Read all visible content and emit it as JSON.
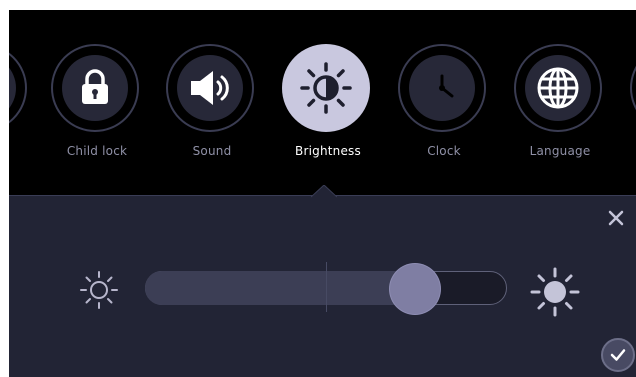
{
  "menu": {
    "items": [
      {
        "label": "",
        "icon": "partial-icon"
      },
      {
        "label": "Child lock",
        "icon": "padlock-icon"
      },
      {
        "label": "Sound",
        "icon": "speaker-icon"
      },
      {
        "label": "Brightness",
        "icon": "brightness-icon",
        "active": true
      },
      {
        "label": "Clock",
        "icon": "clock-icon"
      },
      {
        "label": "Language",
        "icon": "globe-icon"
      },
      {
        "label": "",
        "icon": "partial-icon"
      }
    ]
  },
  "brightness": {
    "level": 0.77
  },
  "colors": {
    "background": "#000000",
    "panel": "#222435",
    "active_circle": "#c9c8df",
    "thumb": "#7f7ea3",
    "inactive_label": "#8f90a6"
  }
}
